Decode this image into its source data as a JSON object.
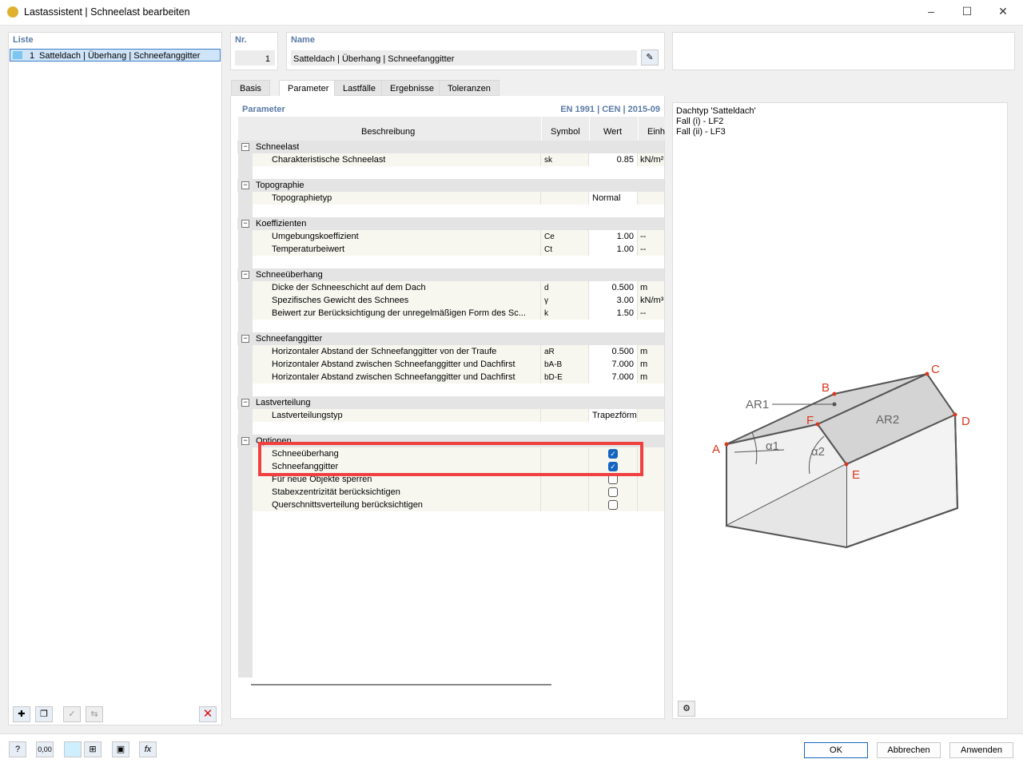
{
  "window": {
    "title": "Lastassistent | Schneelast bearbeiten"
  },
  "list": {
    "header": "Liste",
    "items": [
      {
        "nr": "1",
        "label": "Satteldach | Überhang | Schneefanggitter"
      }
    ]
  },
  "nr": {
    "label": "Nr.",
    "value": "1"
  },
  "name": {
    "label": "Name",
    "value": "Satteldach | Überhang | Schneefanggitter"
  },
  "tabs": [
    "Basis",
    "Parameter",
    "Lastfälle",
    "Ergebnisse",
    "Toleranzen"
  ],
  "active_tab": "Parameter",
  "params": {
    "title": "Parameter",
    "norm": "EN 1991 | CEN | 2015-09",
    "columns": [
      "Beschreibung",
      "Symbol",
      "Wert",
      "Einh"
    ],
    "rows": [
      {
        "type": "group",
        "label": "Schneelast"
      },
      {
        "type": "item",
        "label": "Charakteristische Schneelast",
        "symbol": "sk",
        "value": "0.85",
        "unit": "kN/m²"
      },
      {
        "type": "blank"
      },
      {
        "type": "group",
        "label": "Topographie"
      },
      {
        "type": "item",
        "label": "Topographietyp",
        "symbol": "",
        "text": "Normal",
        "unit": ""
      },
      {
        "type": "blank"
      },
      {
        "type": "group",
        "label": "Koeffizienten"
      },
      {
        "type": "item",
        "label": "Umgebungskoeffizient",
        "symbol": "Ce",
        "value": "1.00",
        "unit": "--"
      },
      {
        "type": "item",
        "label": "Temperaturbeiwert",
        "symbol": "Ct",
        "value": "1.00",
        "unit": "--"
      },
      {
        "type": "blank"
      },
      {
        "type": "group",
        "label": "Schneeüberhang"
      },
      {
        "type": "item",
        "label": "Dicke der Schneeschicht auf dem Dach",
        "symbol": "d",
        "value": "0.500",
        "unit": "m"
      },
      {
        "type": "item",
        "label": "Spezifisches Gewicht des Schnees",
        "symbol": "γ",
        "value": "3.00",
        "unit": "kN/m³"
      },
      {
        "type": "item",
        "label": "Beiwert zur Berücksichtigung der unregelmäßigen Form des Sc...",
        "symbol": "k",
        "value": "1.50",
        "unit": "--"
      },
      {
        "type": "blank"
      },
      {
        "type": "group",
        "label": "Schneefanggitter"
      },
      {
        "type": "item",
        "label": "Horizontaler Abstand der Schneefanggitter von der Traufe",
        "symbol": "aR",
        "value": "0.500",
        "unit": "m"
      },
      {
        "type": "item",
        "label": "Horizontaler Abstand zwischen Schneefanggitter und Dachfirst",
        "symbol": "bA-B",
        "value": "7.000",
        "unit": "m"
      },
      {
        "type": "item",
        "label": "Horizontaler Abstand zwischen Schneefanggitter und Dachfirst",
        "symbol": "bD-E",
        "value": "7.000",
        "unit": "m"
      },
      {
        "type": "blank"
      },
      {
        "type": "group",
        "label": "Lastverteilung"
      },
      {
        "type": "item",
        "label": "Lastverteilungstyp",
        "symbol": "",
        "text": "Trapezförmig",
        "unit": ""
      },
      {
        "type": "blank"
      },
      {
        "type": "group",
        "label": "Optionen"
      },
      {
        "type": "check",
        "label": "Schneeüberhang",
        "checked": true
      },
      {
        "type": "check",
        "label": "Schneefanggitter",
        "checked": true
      },
      {
        "type": "check",
        "label": "Für neue Objekte sperren",
        "checked": false
      },
      {
        "type": "check",
        "label": "Stabexzentrizität berücksichtigen",
        "checked": false
      },
      {
        "type": "check",
        "label": "Querschnittsverteilung berücksichtigen",
        "checked": false
      }
    ]
  },
  "info": {
    "lines": [
      "Dachtyp 'Satteldach'",
      "Fall (i) - LF2",
      "Fall (ii) - LF3"
    ]
  },
  "diagram": {
    "points": [
      "A",
      "B",
      "C",
      "D",
      "E",
      "F"
    ],
    "labels": {
      "ar1": "AR1",
      "ar2": "AR2",
      "a1": "α1",
      "a2": "α2"
    },
    "accent": "#d9381e"
  },
  "highlight_color": "#f04040",
  "buttons": {
    "ok": "OK",
    "cancel": "Abbrechen",
    "apply": "Anwenden"
  },
  "bottom_tools": {
    "value": "0,00"
  }
}
